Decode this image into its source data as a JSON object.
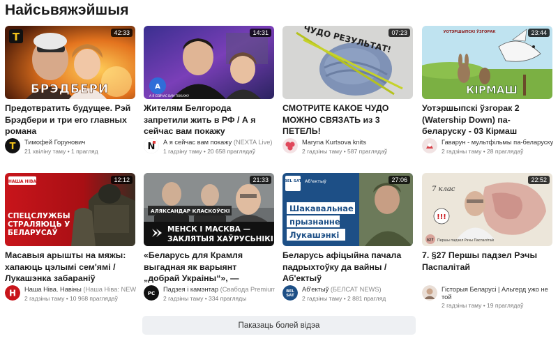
{
  "section": {
    "title": "Найсьвяжэйшыя"
  },
  "videos": [
    {
      "title": "Предотвратить будущее. Рэй Брэдбери и три его главных романа",
      "duration": "42:33",
      "thumb_text": "БРЭДБЕРИ",
      "logo_letter": "T",
      "channel": "Тимофей Горунович",
      "channel_sub": "",
      "meta": "21 хвіліну таму • 1 прагляд",
      "avatar_letter": "T"
    },
    {
      "title": "Жителям Белгорода запретили жить в РФ / А я сейчас вам покажу",
      "duration": "14:31",
      "thumb_text": "А Я СЕЙЧАС ВАМ ПОКАЖУ",
      "channel": "А я сейчас вам покажу",
      "channel_sub": "(NEXTA Live)",
      "meta": "1 гадзіну таму • 20 658 праглядаў",
      "avatar_letter": "N"
    },
    {
      "title": "СМОТРИТЕ КАКОЕ ЧУДО МОЖНО СВЯЗАТЬ из 3 ПЕТЕЛЬ!",
      "duration": "07:23",
      "thumb_text": "ЧУДО РЕЗУЛЬТАТ!",
      "channel": "Maryna Kurtsova knits",
      "channel_sub": "",
      "meta": "2 гадзіны таму • 587 праглядаў",
      "avatar_letter": ""
    },
    {
      "title": "Уотэршыпскі ўзгорак 2 (Watership Down) па-беларуску - 03 Кірмаш",
      "duration": "23:44",
      "thumb_text": "КІРМАШ",
      "thumb_text2": "УОТЭРШЫПСКІ ЎЗГОРАК",
      "channel": "Гаварун - мультфільмы па-беларуску",
      "channel_sub": "",
      "meta": "2 гадзіны таму • 28 праглядаў",
      "avatar_letter": ""
    },
    {
      "title": "Масавыя арышты на мяжы: хапаюць цэлымі сем'ямі / Лукашэнка забараніў скардзіцца",
      "duration": "12:12",
      "thumb_text": "СПЕЦСЛУЖБЫ СТРАЛЯЮЦЬ У БЕЛАРУСАЎ",
      "logo_text": "НАША НІВА",
      "channel": "Наша Ніва. Навіны",
      "channel_sub": "(Наша Ніва: NEWS)",
      "meta": "2 гадзіны таму • 10 968 праглядаў",
      "avatar_letter": "Н"
    },
    {
      "title": "«Беларусь для Крамля выгадная як варыянт „добрай Украіны“», — Класкоўскі",
      "duration": "21:33",
      "thumb_name": "АЛЯКСАНДАР КЛАСКОЎСКІ",
      "thumb_text": "МЕНСК І МАСКВА —",
      "thumb_text2": "ЗАКЛЯТЫЯ ХАЎРУСЬНІКІ",
      "channel": "Падзея і камэнтар",
      "channel_sub": "(Свабода Premium)",
      "meta": "2 гадзіны таму • 334 прагляды",
      "avatar_letter": "РС"
    },
    {
      "title": "Беларусь афіцыйна пачала падрыхтоўку да вайны / Аб'ектыў",
      "duration": "27:06",
      "logo_text": "BEL SAT",
      "tag_text": "Аб'ектыў",
      "thumb_text": "Шакавальнае",
      "thumb_text2": "прызнанне",
      "thumb_text3": "Лукашэнкі",
      "channel": "Аб'ектыў",
      "channel_sub": "(БЕЛСАТ NEWS)",
      "meta": "2 гадзіны таму • 2 881 прагляд",
      "avatar_letter": "BEL SAT"
    },
    {
      "title": "7. §27 Першы падзел Рэчы Паспалітай",
      "duration": "22:52",
      "thumb_text": "7 клас",
      "thumb_text2": "Першы падзел Рэчы Паспалітай",
      "thumb_num": "§27",
      "channel": "Гісторыя Беларусі | Альгерд ужо не той",
      "channel_sub": "",
      "meta": "2 гадзіны таму • 19 праглядаў",
      "avatar_letter": ""
    }
  ],
  "more_button": {
    "label": "Паказаць болей відэа"
  }
}
